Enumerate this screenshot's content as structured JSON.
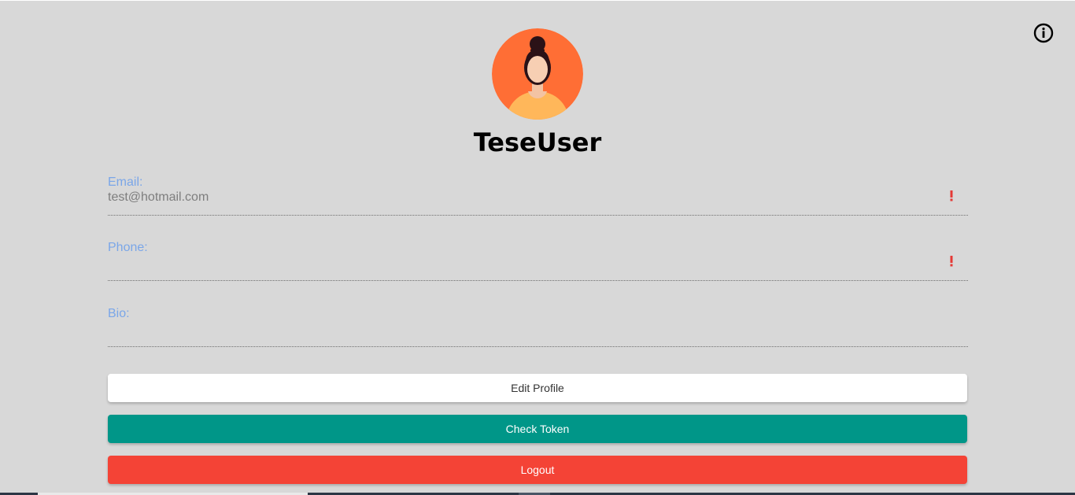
{
  "profile": {
    "username": "TeseUser"
  },
  "fields": {
    "email": {
      "label": "Email:",
      "value": "test@hotmail.com"
    },
    "phone": {
      "label": "Phone:",
      "value": ""
    },
    "bio": {
      "label": "Bio:",
      "value": ""
    }
  },
  "buttons": {
    "edit_profile": "Edit Profile",
    "check_token": "Check Token",
    "logout": "Logout"
  },
  "icons": {
    "info": "info-icon",
    "avatar": "avatar-icon",
    "alert": "exclamation-icon"
  },
  "colors": {
    "background": "#d8d8d8",
    "label": "#7aa6e8",
    "check_token": "#009688",
    "logout": "#f44336",
    "alert": "#e53935"
  }
}
